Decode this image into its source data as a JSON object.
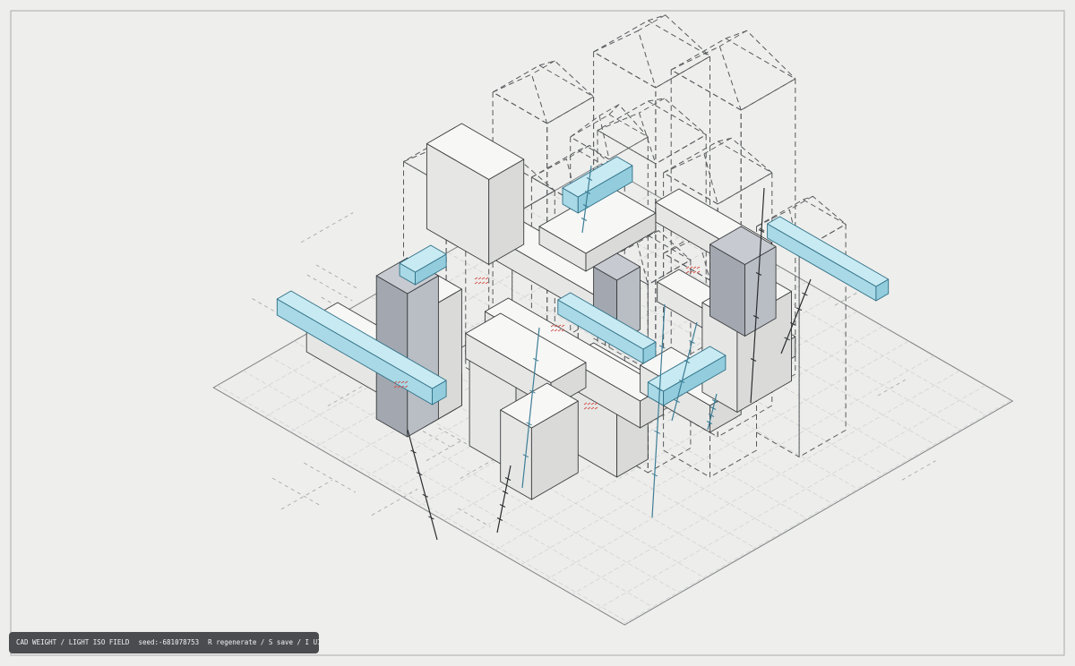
{
  "app": {
    "title_label": "CAD WEIGHT / LIGHT ISO FIELD",
    "seed_text": "seed:-681078753",
    "controls_text": "R regenerate / S save / I UI / Space pause"
  },
  "colors": {
    "background": "#eeeeec",
    "ink": "#2a2c2e",
    "dashed": "#56595c",
    "grid": "#c9ccce",
    "accent_blue": "#a9d9e6",
    "accent_blue_stroke": "#3d7e96",
    "shadow_panel": "#a3a8b0",
    "red_hatch": "#d0433a",
    "hud_bg": "#4a4c50",
    "hud_text": "#f3f3f3"
  }
}
